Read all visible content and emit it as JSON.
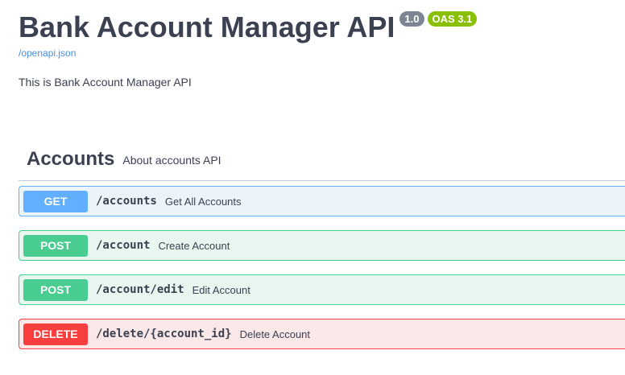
{
  "header": {
    "title": "Bank Account Manager API",
    "version_badge": "1.0",
    "oas_badge": "OAS 3.1",
    "spec_link": "/openapi.json",
    "description": "This is Bank Account Manager API"
  },
  "tag": {
    "name": "Accounts",
    "description": "About accounts API"
  },
  "operations": [
    {
      "method": "GET",
      "path": "/accounts",
      "summary": "Get All Accounts"
    },
    {
      "method": "POST",
      "path": "/account",
      "summary": "Create Account"
    },
    {
      "method": "POST",
      "path": "/account/edit",
      "summary": "Edit Account"
    },
    {
      "method": "DELETE",
      "path": "/delete/{account_id}",
      "summary": "Delete Account"
    }
  ],
  "colors": {
    "get": "#61affe",
    "post": "#49cc90",
    "delete": "#f93e3e",
    "link": "#4990e2",
    "text": "#3b4151"
  }
}
